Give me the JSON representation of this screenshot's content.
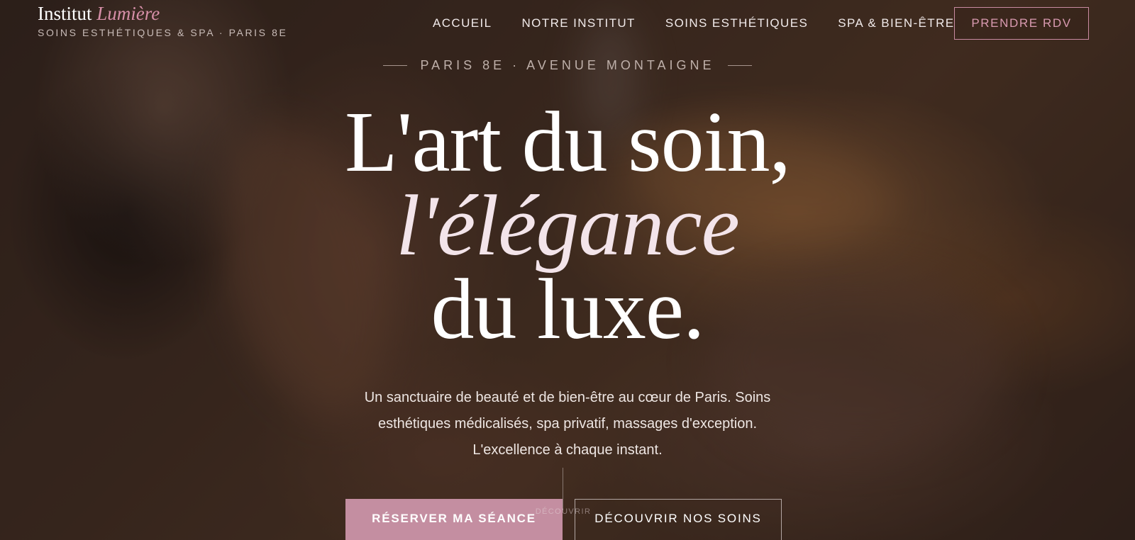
{
  "brand": {
    "name": "Institut",
    "name_accent": "Lumière",
    "tagline": "SOINS ESTHÉTIQUES & SPA · PARIS 8E"
  },
  "nav": {
    "items": [
      {
        "label": "ACCUEIL"
      },
      {
        "label": "NOTRE INSTITUT"
      },
      {
        "label": "SOINS ESTHÉTIQUES"
      },
      {
        "label": "SPA & BIEN-ÊTRE"
      }
    ],
    "cta_label": "PRENDRE RDV"
  },
  "hero": {
    "eyebrow": "PARIS 8E · AVENUE MONTAIGNE",
    "headline_line1": "L'art du soin,",
    "headline_line2": "l'élégance",
    "headline_line3": "du luxe.",
    "description": "Un sanctuaire de beauté et de bien-être au cœur de Paris. Soins esthétiques médicalisés, spa privatif, massages d'exception. L'excellence à chaque instant.",
    "scroll_label": "DÉCOUVRIR",
    "primary_button": "RÉSERVER MA SÉANCE",
    "secondary_button": "DÉCOUVRIR NOS SOINS"
  },
  "colors": {
    "accent": "#c48ea1",
    "accent_text": "#d68fa8",
    "text": "#ffffff"
  }
}
